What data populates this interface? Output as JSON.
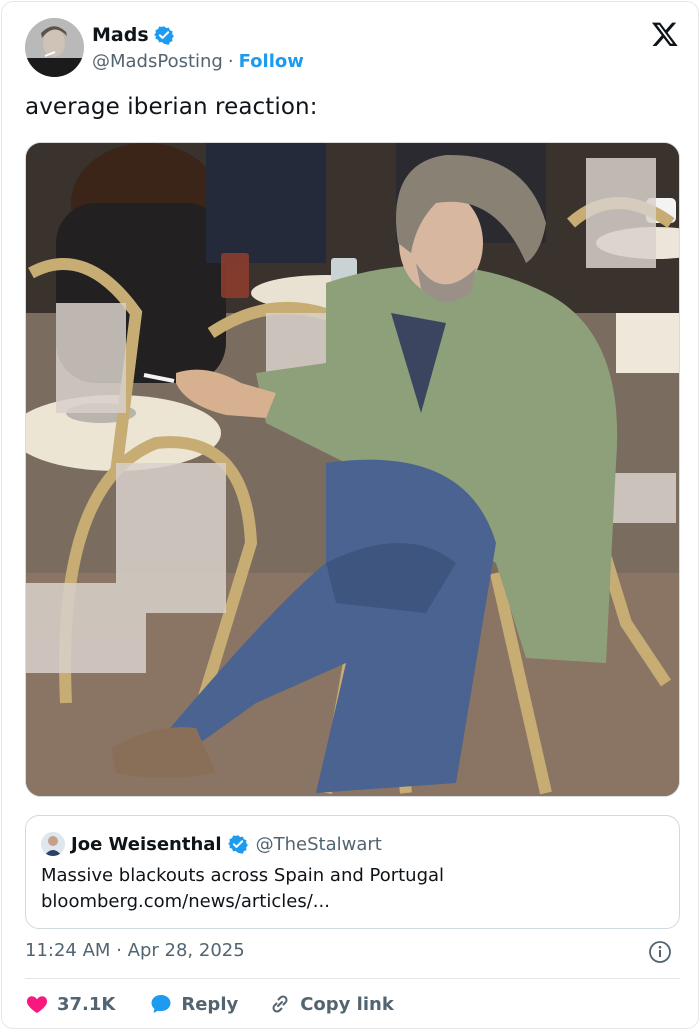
{
  "author": {
    "name": "Mads",
    "handle": "@MadsPosting",
    "separator": "·",
    "follow_label": "Follow"
  },
  "tweet": {
    "text": "average iberian reaction:"
  },
  "quoted_tweet": {
    "name": "Joe Weisenthal",
    "handle": "@TheStalwart",
    "text": "Massive blackouts across Spain and Portugal",
    "link": "bloomberg.com/news/articles/..."
  },
  "meta": {
    "time": "11:24 AM",
    "separator": "·",
    "date": "Apr 28, 2025"
  },
  "actions": {
    "likes": "37.1K",
    "reply_label": "Reply",
    "copy_label": "Copy link"
  },
  "colors": {
    "accent": "#1d9bf0",
    "like": "#f91880",
    "muted": "#536471"
  }
}
